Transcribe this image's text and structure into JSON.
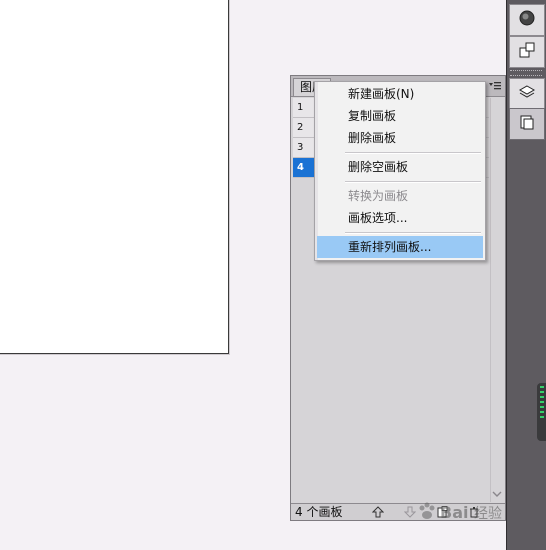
{
  "panel": {
    "tab_label": "图层",
    "rows": [
      "1",
      "2",
      "3",
      "4"
    ],
    "selected_row": "4",
    "footer_count": "4 个画板"
  },
  "menu": {
    "items": [
      {
        "label": "新建画板(N)",
        "disabled": false
      },
      {
        "label": "复制画板",
        "disabled": false
      },
      {
        "label": "删除画板",
        "disabled": false
      },
      {
        "label": "删除空画板",
        "disabled": false
      },
      {
        "label": "转换为画板",
        "disabled": true
      },
      {
        "label": "画板选项...",
        "disabled": false
      },
      {
        "label": "重新排列画板...",
        "disabled": false,
        "highlighted": true
      }
    ]
  },
  "watermark": {
    "text": "Bai 经验"
  },
  "colors": {
    "selection": "#1a72d4",
    "menu_highlight": "#99c9f5",
    "toolstrip": "#5e5b60",
    "canvas": "#f4f1f5"
  }
}
